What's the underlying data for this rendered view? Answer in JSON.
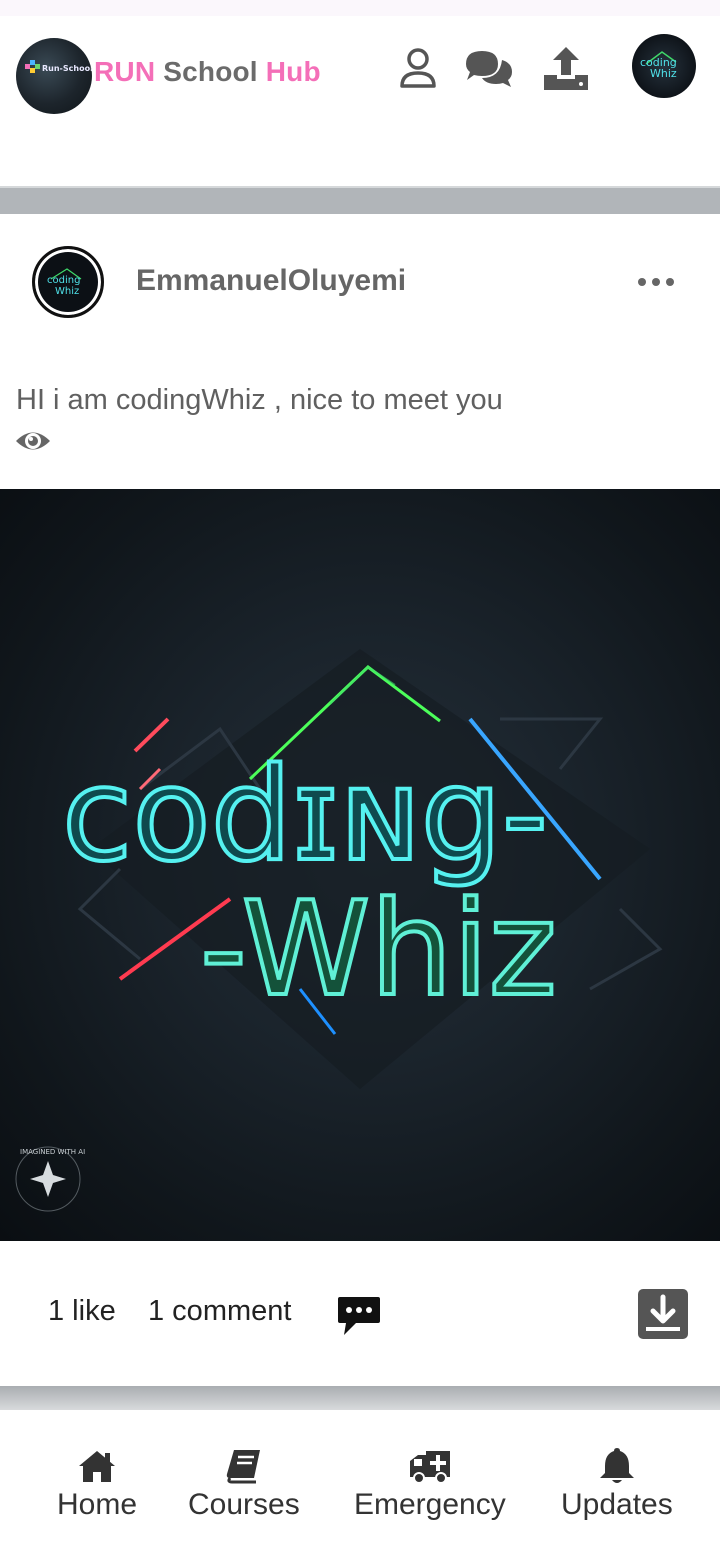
{
  "app": {
    "brand_parts": [
      "RUN",
      " School ",
      "Hub"
    ],
    "logo_text": "Run-School H"
  },
  "header_icons": [
    "user-icon",
    "chat-icon",
    "upload-icon",
    "avatar-icon"
  ],
  "post": {
    "username": "EmmanuelOluyemi",
    "text": "HI i am codingWhiz , nice to meet you",
    "image_text_line1": "codɪɴg-",
    "image_text_line2": "-Whiz",
    "image_badge": "IMAGINED WITH AI",
    "likes": "1 like",
    "comments": "1 comment"
  },
  "nav": {
    "items": [
      {
        "label": "Home",
        "icon": "home-icon"
      },
      {
        "label": "Courses",
        "icon": "book-icon"
      },
      {
        "label": "Emergency",
        "icon": "ambulance-icon"
      },
      {
        "label": "Updates",
        "icon": "bell-icon"
      }
    ]
  },
  "colors": {
    "brand_pink": "#f46fb8",
    "brand_gray": "#6b6b6b",
    "divider": "#b1b5b9"
  }
}
